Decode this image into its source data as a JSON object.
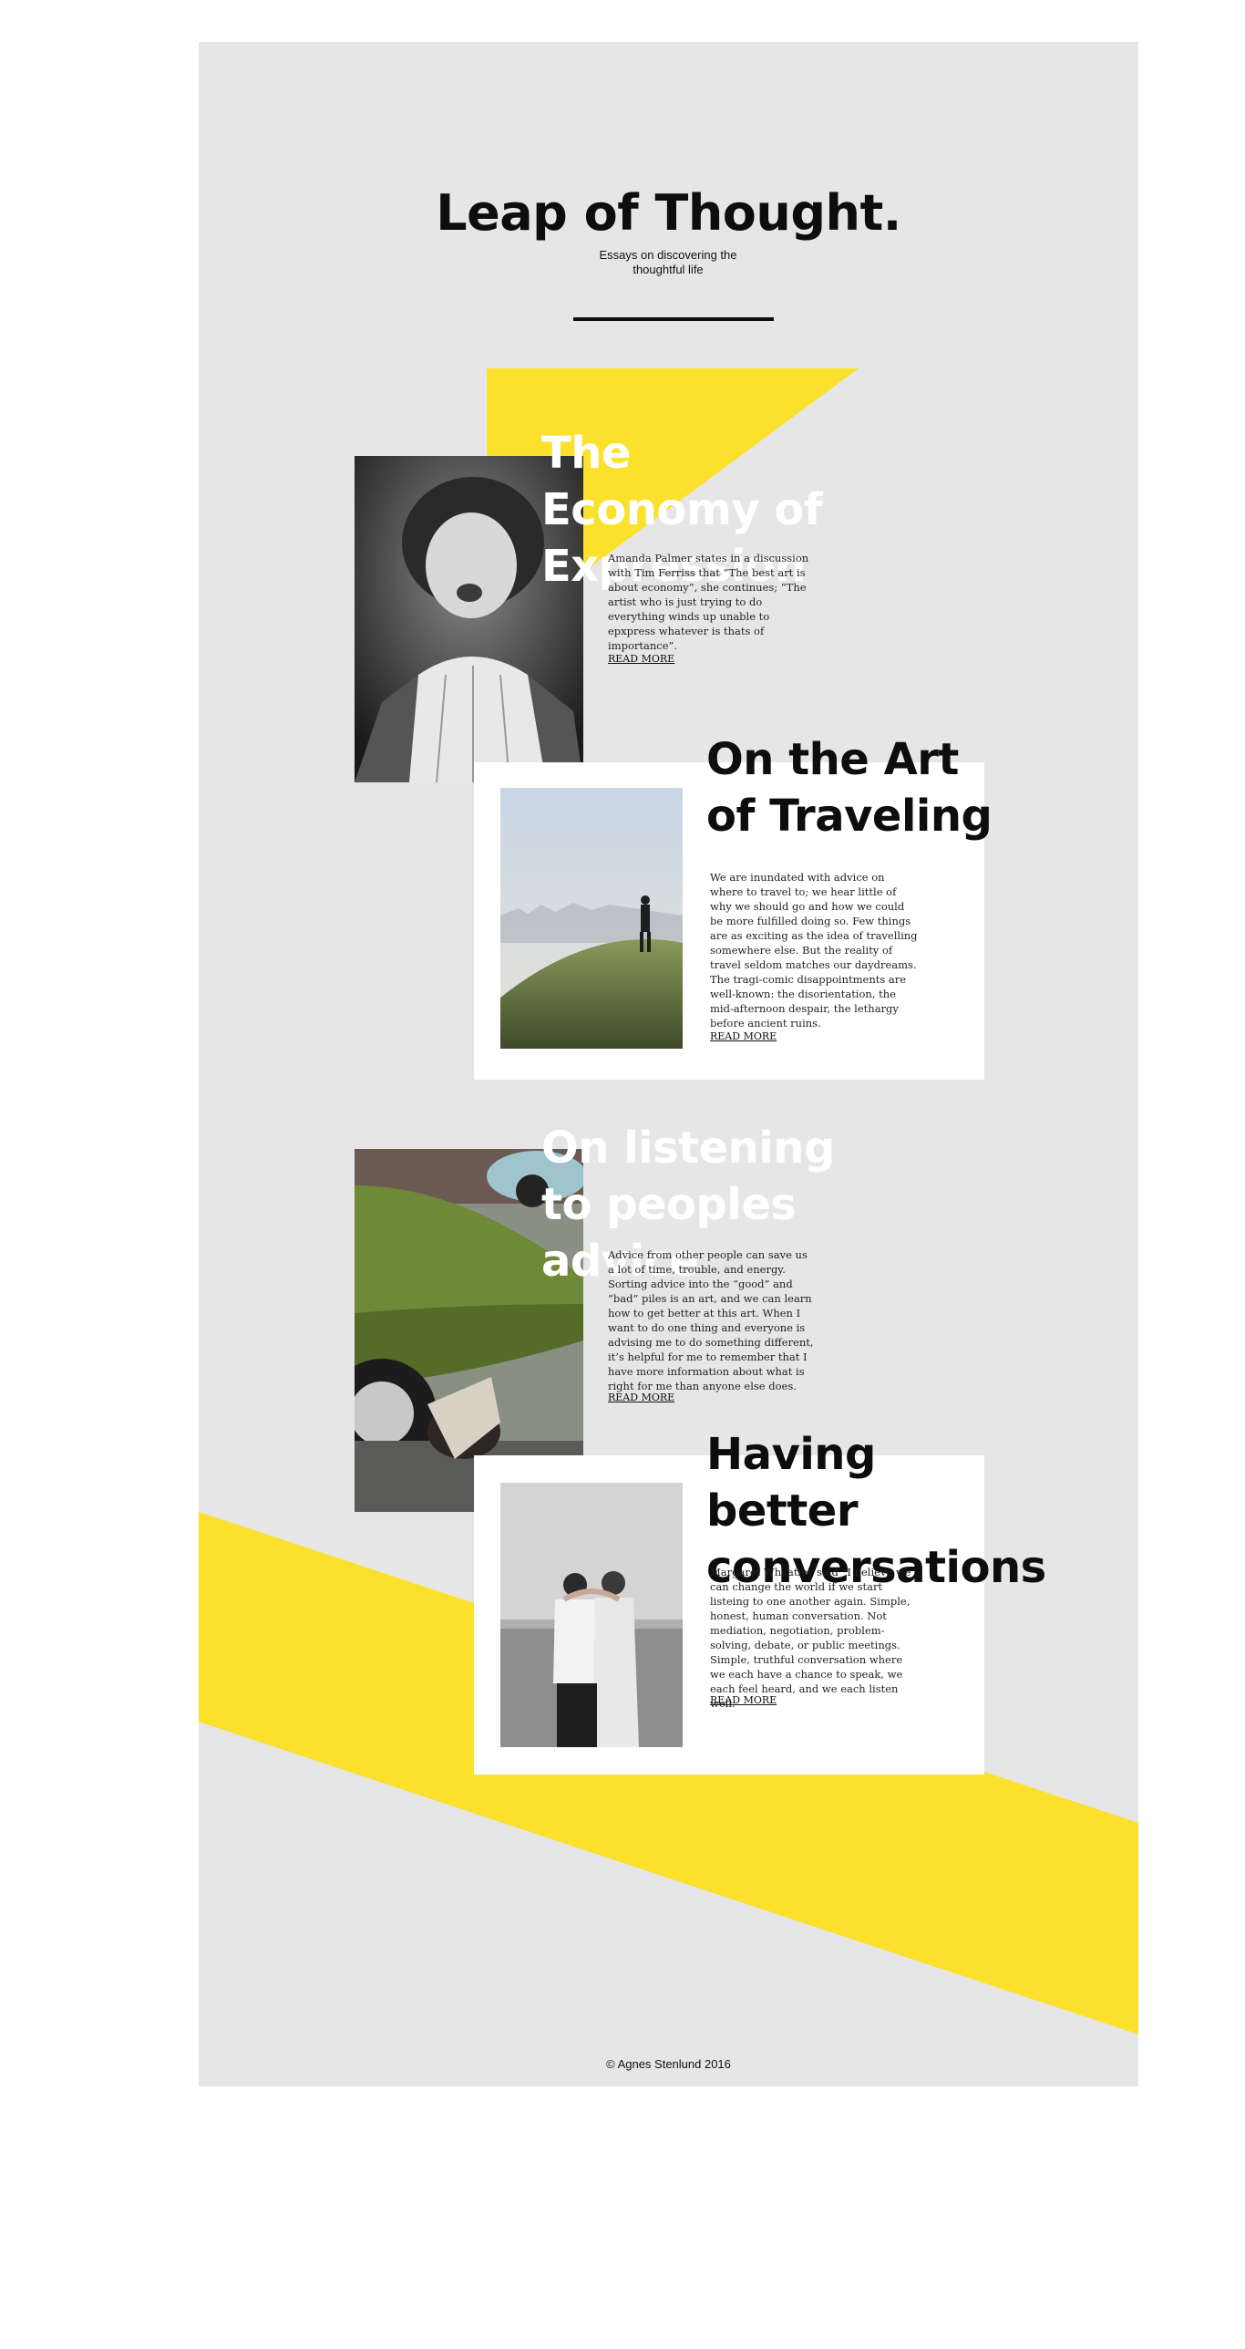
{
  "site": {
    "title": "Leap of Thought.",
    "tagline": "Essays on discovering the thoughtful life"
  },
  "colors": {
    "accent": "#fbe12b",
    "page_background": "#e6e6e6",
    "card_background": "#ffffff",
    "text": "#0d0d0d"
  },
  "essays": [
    {
      "title": "The Economy of Expression",
      "body": "Amanda Palmer states in a discussion with Tim Ferriss that “The best art is about economy”, she continues; “The artist who is just trying to do everything winds up unable to epxpress whatever is thats of importance”.",
      "read_more": "READ MORE",
      "image": "black-and-white portrait of a shouting child"
    },
    {
      "title": "On the Art of Traveling",
      "body": "We are inundated with advice on where to travel to; we hear little of why we should go and how we could be more fulfilled doing so. Few things are as exciting as the idea of travelling somewhere else. But the reality of travel seldom matches our daydreams. The tragi-comic disappointments are well-known: the disorientation, the mid-afternoon despair, the lethargy before ancient ruins.",
      "read_more": "READ MORE",
      "image": "person standing on a grassy hill overlooking a hazy city"
    },
    {
      "title": "On listening to peoples advice",
      "body": "Advice from other people can save us a lot of time, trouble, and energy. Sorting advice into the “good” and “bad” piles is an art, and we can learn how to get better at this art. When I want to do one thing and everyone is advising me to do something different, it’s helpful for me to remember that I have more information about what is right for me than anyone else does.",
      "read_more": "READ MORE",
      "image": "child crouching beside a green car"
    },
    {
      "title": "Having better conversations",
      "body": "Margaret Wheatley said “I believe we can change the world if we start listeing to one another again. Simple, honest, human conversation. Not mediation, negotiation, problem-solving, debate, or public meetings. Simple, truthful conversation where we each have a chance to speak, we each feel heard, and we each listen well.",
      "read_more": "READ MORE",
      "image": "black-and-white photo of a couple embracing by the sea"
    }
  ],
  "footer": {
    "copyright": "© Agnes Stenlund 2016"
  }
}
